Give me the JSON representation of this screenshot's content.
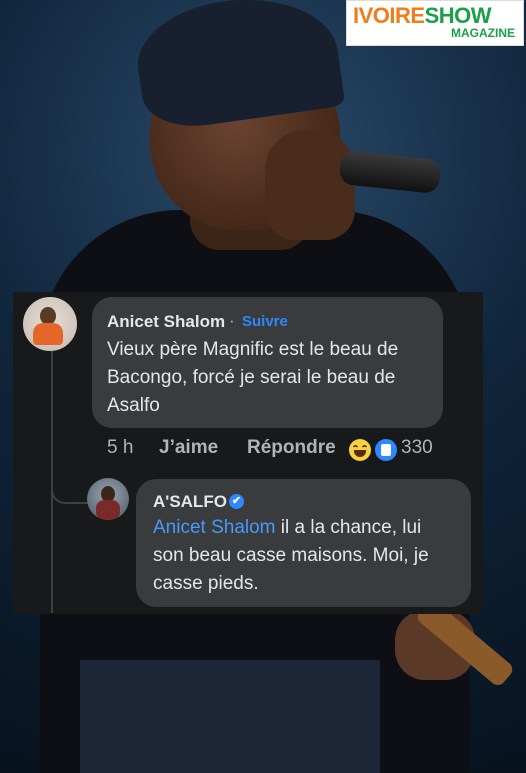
{
  "logo": {
    "part1": "IVOIRE",
    "part2": "SHOW",
    "sub": "MAGAZINE"
  },
  "comment": {
    "author": "Anicet Shalom",
    "separator": "·",
    "follow": "Suivre",
    "line1": "Vieux père Magnific est le beau de",
    "line2": "Bacongo, forcé je serai le beau de",
    "line3": "Asalfo",
    "time": "5 h",
    "like": "J’aime",
    "reply": "Répondre",
    "reaction_count": "330",
    "reactions": [
      "haha-icon",
      "like-icon"
    ]
  },
  "reply": {
    "author": "A'SALFO",
    "verified_icon": "✔",
    "mention": "Anicet Shalom",
    "line1_rest": " il a la chance, lui",
    "line2": "son beau casse maisons. Moi, je",
    "line3": "casse pieds."
  },
  "colors": {
    "panel": "#18191a",
    "bubble": "#3a3b3c",
    "link": "#2d88ff",
    "logo_orange": "#ef7d1a",
    "logo_green": "#19a04a"
  }
}
